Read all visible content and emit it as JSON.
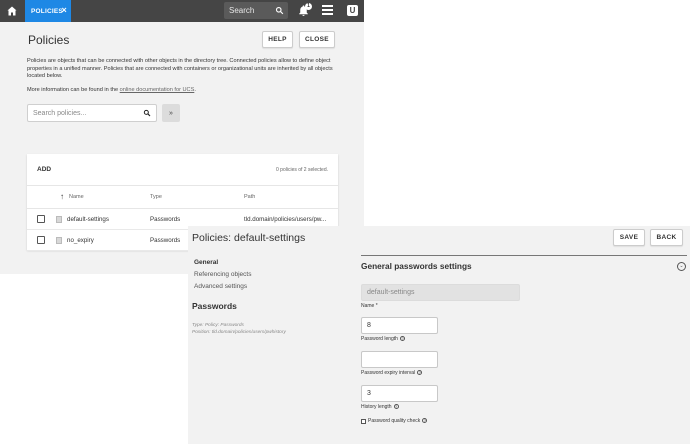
{
  "back_window": {
    "topbar": {
      "tab_label": "POLICIES",
      "tab_close": "×",
      "search_placeholder": "Search",
      "notification_count": "1",
      "logo_letter": "U"
    },
    "title": "Policies",
    "help_label": "HELP",
    "close_label": "CLOSE",
    "description": "Policies are objects that can be connected with other objects in the directory tree. Connected policies allow to define object properties in a unified manner. Policies that are connected with containers or organizational units are inherited by all objects located below.",
    "more_info_prefix": "More information can be found in the ",
    "more_info_link": "online documentation for UCS",
    "more_info_suffix": ".",
    "search_placeholder": "Search policies...",
    "expand_label": "»",
    "grid": {
      "add_label": "ADD",
      "selection_count": "0 policies of 2 selected.",
      "columns": [
        "Name",
        "Type",
        "Path"
      ],
      "rows": [
        {
          "name": "default-settings",
          "type": "Passwords",
          "path": "tld.domain/policies/users/pw..."
        },
        {
          "name": "no_expiry",
          "type": "Passwords",
          "path": ""
        }
      ]
    }
  },
  "front_window": {
    "title": "Policies: default-settings",
    "save_label": "SAVE",
    "back_label": "BACK",
    "nav": {
      "general": "General",
      "referencing": "Referencing objects",
      "advanced": "Advanced settings"
    },
    "object_type_title": "Passwords",
    "meta_type": "Type: Policy: Passwords",
    "meta_position": "Position: tld.domain/policies/users/pwhistory",
    "section_title": "General passwords settings",
    "fields": {
      "name_value": "default-settings",
      "name_label": "Name *",
      "pw_length_value": "8",
      "pw_length_label": "Password length",
      "pw_expiry_value": "",
      "pw_expiry_label": "Password expiry interval",
      "history_value": "3",
      "history_label": "History length",
      "quality_check_label": "Password quality check"
    }
  },
  "colors": {
    "topbar": "#454545",
    "tab_active": "#1e88e5",
    "background": "#f2f2f2"
  }
}
